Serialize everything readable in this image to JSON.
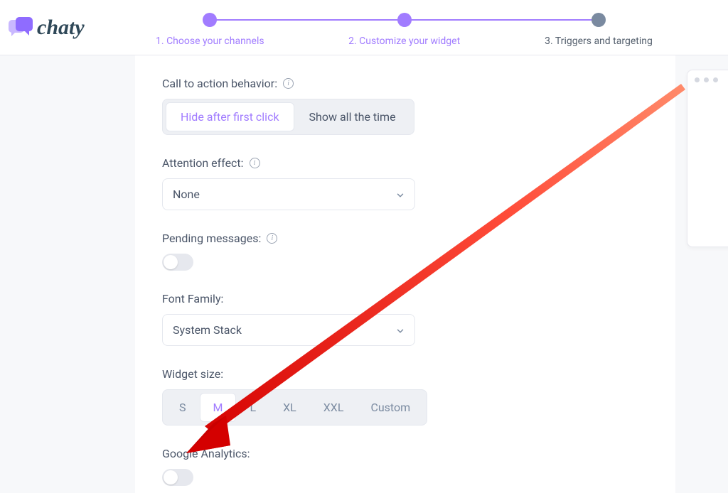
{
  "brand": {
    "name": "chaty"
  },
  "stepper": {
    "steps": [
      {
        "label": "1. Choose your channels",
        "state": "done"
      },
      {
        "label": "2. Customize your widget",
        "state": "done"
      },
      {
        "label": "3. Triggers and targeting",
        "state": "upcoming"
      }
    ]
  },
  "cta_behavior": {
    "label": "Call to action behavior:",
    "options": [
      "Hide after first click",
      "Show all the time"
    ],
    "selected_index": 0
  },
  "attention_effect": {
    "label": "Attention effect:",
    "value": "None"
  },
  "pending_messages": {
    "label": "Pending messages:",
    "enabled": false
  },
  "font_family": {
    "label": "Font Family:",
    "value": "System Stack"
  },
  "widget_size": {
    "label": "Widget size:",
    "options": [
      "S",
      "M",
      "L",
      "XL",
      "XXL",
      "Custom"
    ],
    "selected_index": 1
  },
  "google_analytics": {
    "label": "Google Analytics:",
    "enabled": false
  },
  "colors": {
    "accent": "#a17cff",
    "accent_light": "#c9b8ff",
    "text": "#4a5568",
    "muted": "#7a8aa0",
    "annotation": "#e62020"
  }
}
